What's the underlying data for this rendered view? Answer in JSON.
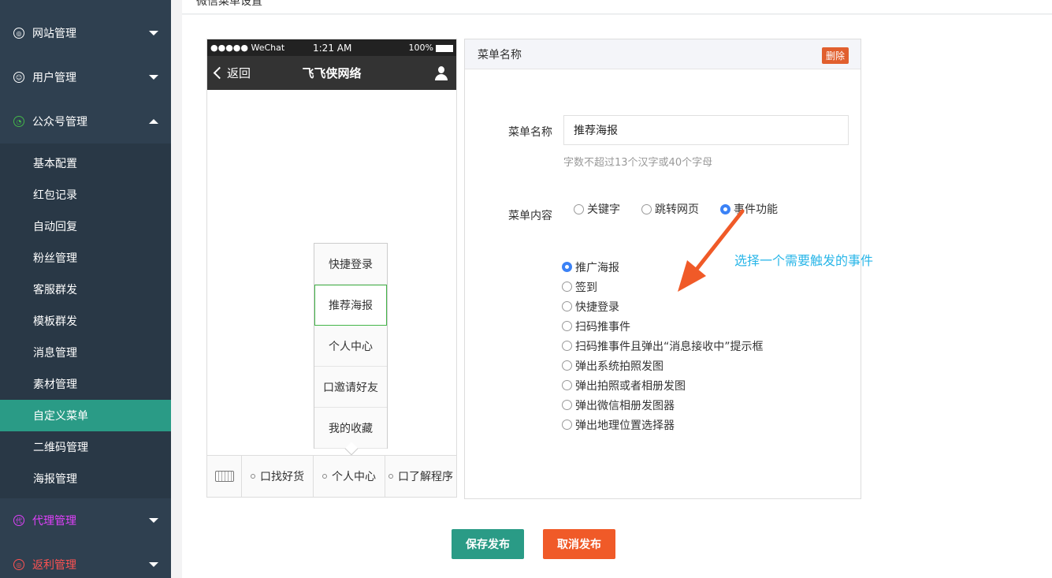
{
  "header": {
    "title": "微信菜单设置"
  },
  "sidebar": {
    "groups": [
      {
        "label": "网站管理",
        "icon": "globe-icon",
        "color": "#ffffff",
        "caret": "down"
      },
      {
        "label": "用户管理",
        "icon": "user-icon",
        "color": "#ffffff",
        "caret": "down"
      },
      {
        "label": "公众号管理",
        "icon": "wechat-icon",
        "color": "#ffffff",
        "caret": "up"
      },
      {
        "label": "代理管理",
        "icon": "agent-icon",
        "color": "#e040fb",
        "caret": "down"
      },
      {
        "label": "返利管理",
        "icon": "rebate-icon",
        "color": "#ff5252",
        "caret": "down"
      }
    ],
    "submenu": [
      "基本配置",
      "红包记录",
      "自动回复",
      "粉丝管理",
      "客服群发",
      "模板群发",
      "消息管理",
      "素材管理",
      "自定义菜单",
      "二维码管理",
      "海报管理"
    ],
    "active_submenu": "自定义菜单"
  },
  "phone": {
    "status": {
      "carrier": "●●●●● WeChat",
      "time": "1:21 AM",
      "battery": "100%"
    },
    "navbar": {
      "back": "返回",
      "title": "飞飞侠网络"
    },
    "popup": [
      "快捷登录",
      "推荐海报",
      "个人中心",
      "口邀请好友",
      "我的收藏"
    ],
    "popup_selected": "推荐海报",
    "tabs": [
      "口找好货",
      "个人中心",
      "口了解程序"
    ]
  },
  "editor": {
    "header": "菜单名称",
    "delete_label": "删除",
    "name_label": "菜单名称",
    "name_value": "推荐海报",
    "name_hint": "字数不超过13个汉字或40个字母",
    "content_label": "菜单内容",
    "content_options": [
      "关键字",
      "跳转网页",
      "事件功能"
    ],
    "content_selected": "事件功能",
    "events": [
      "推广海报",
      "签到",
      "快捷登录",
      "扫码推事件",
      "扫码推事件且弹出“消息接收中”提示框",
      "弹出系统拍照发图",
      "弹出拍照或者相册发图",
      "弹出微信相册发图器",
      "弹出地理位置选择器"
    ],
    "event_selected": "推广海报"
  },
  "annotation": {
    "text": "选择一个需要触发的事件",
    "color": "#29b6e8"
  },
  "actions": {
    "save": "保存发布",
    "cancel": "取消发布"
  },
  "colors": {
    "sidebar_bg": "#2f4050",
    "active": "#2a9b86",
    "danger": "#f05a28"
  }
}
